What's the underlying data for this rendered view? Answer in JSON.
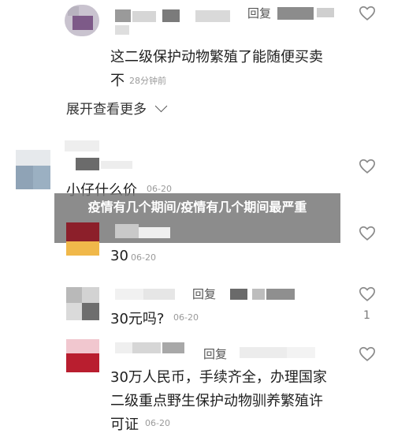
{
  "overlay": {
    "title": "疫情有几个期间/疫情有几个期间最严重"
  },
  "comments": [
    {
      "reply_label": "回复",
      "text_line1": "这二级保护动物繁殖了能随便买卖",
      "text_line2": "不",
      "time": "28分钟前",
      "expand": "展开查看更多"
    },
    {
      "text": "小仔什么价",
      "time": "06-20"
    },
    {
      "text": "30",
      "time": "06-20"
    },
    {
      "reply_label": "回复",
      "text": "30元吗?",
      "time": "06-20",
      "likes": "1"
    },
    {
      "reply_label": "回复",
      "text_line1": "30万人民币，手续齐全，办理国家",
      "text_line2": "二级重点野生保护动物驯养繁殖许",
      "text_line3": "可证",
      "time": "06-20"
    }
  ],
  "icons": {
    "heart": "heart-outline-icon",
    "chevron": "chevron-down-icon"
  }
}
